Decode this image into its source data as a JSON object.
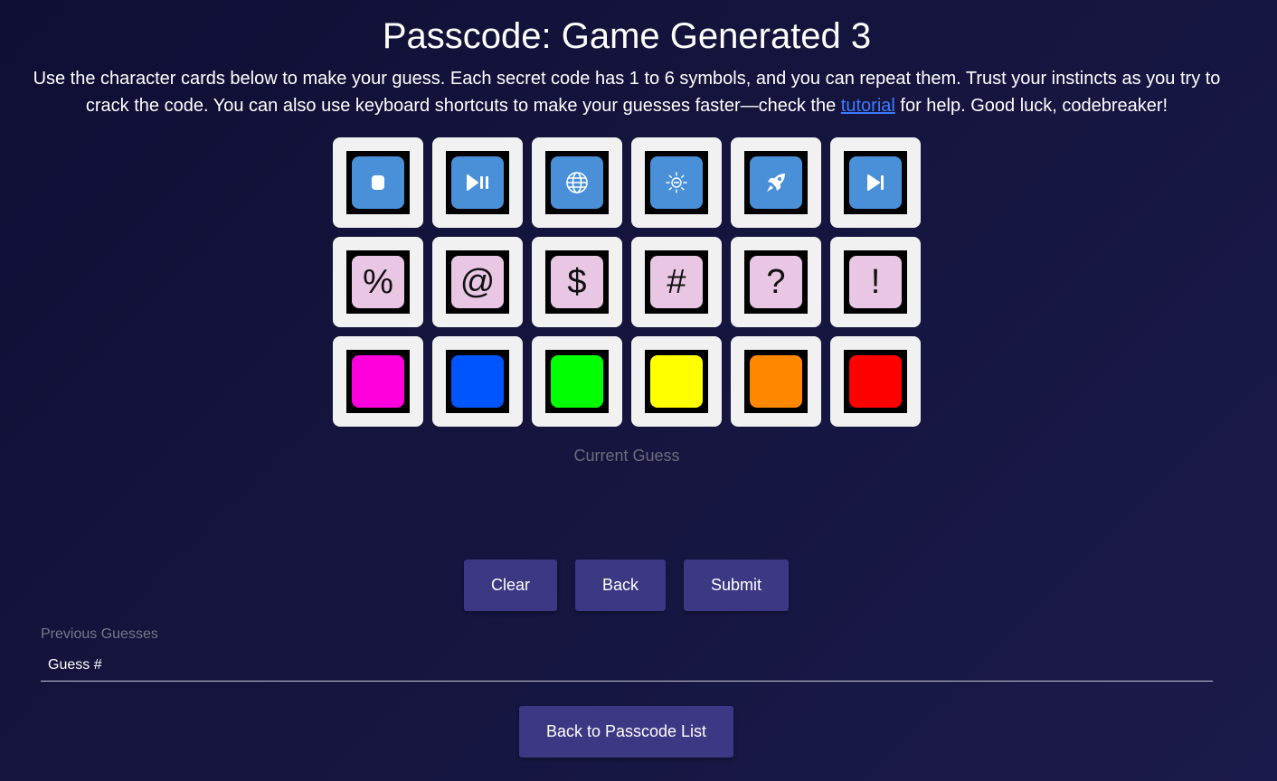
{
  "title": "Passcode: Game Generated 3",
  "intro": {
    "before_link": "Use the character cards below to make your guess. Each secret code has 1 to 6 symbols, and you can repeat them. Trust your instincts as you try to crack the code. You can also use keyboard shortcuts to make your guesses faster—check the ",
    "link_text": "tutorial",
    "after_link": " for help. Good luck, codebreaker!"
  },
  "cards": {
    "icons": [
      {
        "icon": "stop-icon"
      },
      {
        "icon": "play-pause-icon"
      },
      {
        "icon": "globe-icon"
      },
      {
        "icon": "sun-icon"
      },
      {
        "icon": "rocket-icon"
      },
      {
        "icon": "skip-forward-icon"
      }
    ],
    "icon_color": "#4a90d9",
    "symbols": [
      "%",
      "@",
      "$",
      "#",
      "?",
      "!"
    ],
    "symbol_color": "#e8c6e4",
    "colors": [
      "#ff00dd",
      "#0055ff",
      "#00ff00",
      "#ffff00",
      "#ff8800",
      "#ff0000"
    ]
  },
  "current_guess_label": "Current Guess",
  "buttons": {
    "clear": "Clear",
    "back": "Back",
    "submit": "Submit",
    "back_to_list": "Back to Passcode List"
  },
  "previous_guesses": {
    "label": "Previous Guesses",
    "column_header": "Guess #"
  }
}
